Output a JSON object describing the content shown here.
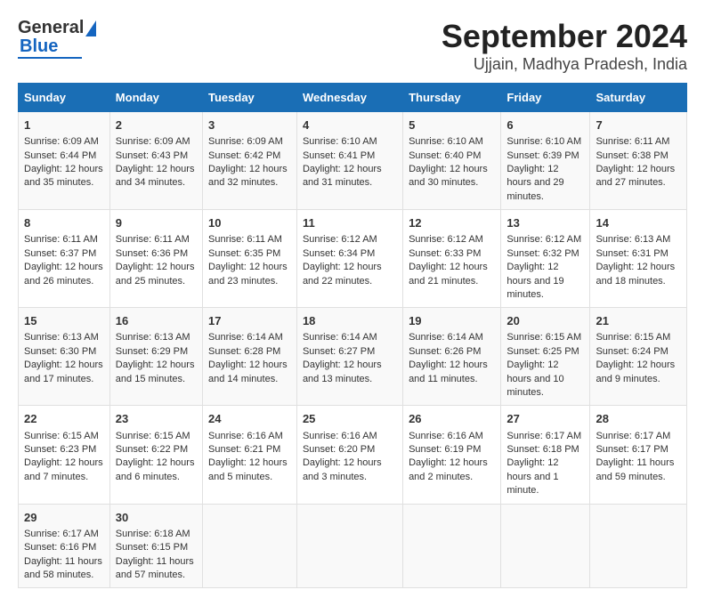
{
  "header": {
    "logo_general": "General",
    "logo_blue": "Blue",
    "title": "September 2024",
    "subtitle": "Ujjain, Madhya Pradesh, India"
  },
  "days_of_week": [
    "Sunday",
    "Monday",
    "Tuesday",
    "Wednesday",
    "Thursday",
    "Friday",
    "Saturday"
  ],
  "weeks": [
    [
      {
        "day": "1",
        "sunrise": "Sunrise: 6:09 AM",
        "sunset": "Sunset: 6:44 PM",
        "daylight": "Daylight: 12 hours and 35 minutes."
      },
      {
        "day": "2",
        "sunrise": "Sunrise: 6:09 AM",
        "sunset": "Sunset: 6:43 PM",
        "daylight": "Daylight: 12 hours and 34 minutes."
      },
      {
        "day": "3",
        "sunrise": "Sunrise: 6:09 AM",
        "sunset": "Sunset: 6:42 PM",
        "daylight": "Daylight: 12 hours and 32 minutes."
      },
      {
        "day": "4",
        "sunrise": "Sunrise: 6:10 AM",
        "sunset": "Sunset: 6:41 PM",
        "daylight": "Daylight: 12 hours and 31 minutes."
      },
      {
        "day": "5",
        "sunrise": "Sunrise: 6:10 AM",
        "sunset": "Sunset: 6:40 PM",
        "daylight": "Daylight: 12 hours and 30 minutes."
      },
      {
        "day": "6",
        "sunrise": "Sunrise: 6:10 AM",
        "sunset": "Sunset: 6:39 PM",
        "daylight": "Daylight: 12 hours and 29 minutes."
      },
      {
        "day": "7",
        "sunrise": "Sunrise: 6:11 AM",
        "sunset": "Sunset: 6:38 PM",
        "daylight": "Daylight: 12 hours and 27 minutes."
      }
    ],
    [
      {
        "day": "8",
        "sunrise": "Sunrise: 6:11 AM",
        "sunset": "Sunset: 6:37 PM",
        "daylight": "Daylight: 12 hours and 26 minutes."
      },
      {
        "day": "9",
        "sunrise": "Sunrise: 6:11 AM",
        "sunset": "Sunset: 6:36 PM",
        "daylight": "Daylight: 12 hours and 25 minutes."
      },
      {
        "day": "10",
        "sunrise": "Sunrise: 6:11 AM",
        "sunset": "Sunset: 6:35 PM",
        "daylight": "Daylight: 12 hours and 23 minutes."
      },
      {
        "day": "11",
        "sunrise": "Sunrise: 6:12 AM",
        "sunset": "Sunset: 6:34 PM",
        "daylight": "Daylight: 12 hours and 22 minutes."
      },
      {
        "day": "12",
        "sunrise": "Sunrise: 6:12 AM",
        "sunset": "Sunset: 6:33 PM",
        "daylight": "Daylight: 12 hours and 21 minutes."
      },
      {
        "day": "13",
        "sunrise": "Sunrise: 6:12 AM",
        "sunset": "Sunset: 6:32 PM",
        "daylight": "Daylight: 12 hours and 19 minutes."
      },
      {
        "day": "14",
        "sunrise": "Sunrise: 6:13 AM",
        "sunset": "Sunset: 6:31 PM",
        "daylight": "Daylight: 12 hours and 18 minutes."
      }
    ],
    [
      {
        "day": "15",
        "sunrise": "Sunrise: 6:13 AM",
        "sunset": "Sunset: 6:30 PM",
        "daylight": "Daylight: 12 hours and 17 minutes."
      },
      {
        "day": "16",
        "sunrise": "Sunrise: 6:13 AM",
        "sunset": "Sunset: 6:29 PM",
        "daylight": "Daylight: 12 hours and 15 minutes."
      },
      {
        "day": "17",
        "sunrise": "Sunrise: 6:14 AM",
        "sunset": "Sunset: 6:28 PM",
        "daylight": "Daylight: 12 hours and 14 minutes."
      },
      {
        "day": "18",
        "sunrise": "Sunrise: 6:14 AM",
        "sunset": "Sunset: 6:27 PM",
        "daylight": "Daylight: 12 hours and 13 minutes."
      },
      {
        "day": "19",
        "sunrise": "Sunrise: 6:14 AM",
        "sunset": "Sunset: 6:26 PM",
        "daylight": "Daylight: 12 hours and 11 minutes."
      },
      {
        "day": "20",
        "sunrise": "Sunrise: 6:15 AM",
        "sunset": "Sunset: 6:25 PM",
        "daylight": "Daylight: 12 hours and 10 minutes."
      },
      {
        "day": "21",
        "sunrise": "Sunrise: 6:15 AM",
        "sunset": "Sunset: 6:24 PM",
        "daylight": "Daylight: 12 hours and 9 minutes."
      }
    ],
    [
      {
        "day": "22",
        "sunrise": "Sunrise: 6:15 AM",
        "sunset": "Sunset: 6:23 PM",
        "daylight": "Daylight: 12 hours and 7 minutes."
      },
      {
        "day": "23",
        "sunrise": "Sunrise: 6:15 AM",
        "sunset": "Sunset: 6:22 PM",
        "daylight": "Daylight: 12 hours and 6 minutes."
      },
      {
        "day": "24",
        "sunrise": "Sunrise: 6:16 AM",
        "sunset": "Sunset: 6:21 PM",
        "daylight": "Daylight: 12 hours and 5 minutes."
      },
      {
        "day": "25",
        "sunrise": "Sunrise: 6:16 AM",
        "sunset": "Sunset: 6:20 PM",
        "daylight": "Daylight: 12 hours and 3 minutes."
      },
      {
        "day": "26",
        "sunrise": "Sunrise: 6:16 AM",
        "sunset": "Sunset: 6:19 PM",
        "daylight": "Daylight: 12 hours and 2 minutes."
      },
      {
        "day": "27",
        "sunrise": "Sunrise: 6:17 AM",
        "sunset": "Sunset: 6:18 PM",
        "daylight": "Daylight: 12 hours and 1 minute."
      },
      {
        "day": "28",
        "sunrise": "Sunrise: 6:17 AM",
        "sunset": "Sunset: 6:17 PM",
        "daylight": "Daylight: 11 hours and 59 minutes."
      }
    ],
    [
      {
        "day": "29",
        "sunrise": "Sunrise: 6:17 AM",
        "sunset": "Sunset: 6:16 PM",
        "daylight": "Daylight: 11 hours and 58 minutes."
      },
      {
        "day": "30",
        "sunrise": "Sunrise: 6:18 AM",
        "sunset": "Sunset: 6:15 PM",
        "daylight": "Daylight: 11 hours and 57 minutes."
      },
      null,
      null,
      null,
      null,
      null
    ]
  ]
}
